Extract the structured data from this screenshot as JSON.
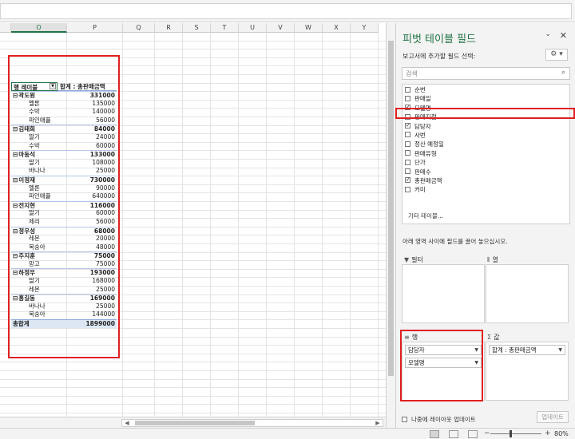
{
  "columns": [
    "O",
    "P",
    "Q",
    "R",
    "S",
    "T",
    "U",
    "V",
    "W",
    "X",
    "Y"
  ],
  "pivot": {
    "row_label_header": "행 레이블",
    "sum_header": "합계 : 총판매금액",
    "groups": [
      {
        "name": "곽도원",
        "total": "331000",
        "items": [
          {
            "name": "멜론",
            "value": "135000"
          },
          {
            "name": "수박",
            "value": "140000"
          },
          {
            "name": "파인애플",
            "value": "56000"
          }
        ]
      },
      {
        "name": "김태희",
        "total": "84000",
        "items": [
          {
            "name": "딸기",
            "value": "24000"
          },
          {
            "name": "수박",
            "value": "60000"
          }
        ]
      },
      {
        "name": "마동석",
        "total": "133000",
        "items": [
          {
            "name": "딸기",
            "value": "108000"
          },
          {
            "name": "바나나",
            "value": "25000"
          }
        ]
      },
      {
        "name": "이정재",
        "total": "730000",
        "items": [
          {
            "name": "멜론",
            "value": "90000"
          },
          {
            "name": "파인애플",
            "value": "640000"
          }
        ]
      },
      {
        "name": "전지현",
        "total": "116000",
        "items": [
          {
            "name": "딸기",
            "value": "60000"
          },
          {
            "name": "체리",
            "value": "56000"
          }
        ]
      },
      {
        "name": "정우성",
        "total": "68000",
        "items": [
          {
            "name": "레몬",
            "value": "20000"
          },
          {
            "name": "복숭아",
            "value": "48000"
          }
        ]
      },
      {
        "name": "주지훈",
        "total": "75000",
        "items": [
          {
            "name": "망고",
            "value": "75000"
          }
        ]
      },
      {
        "name": "하정우",
        "total": "193000",
        "items": [
          {
            "name": "딸기",
            "value": "168000"
          },
          {
            "name": "레몬",
            "value": "25000"
          }
        ]
      },
      {
        "name": "홍길동",
        "total": "169000",
        "items": [
          {
            "name": "바나나",
            "value": "25000"
          },
          {
            "name": "복숭아",
            "value": "144000"
          }
        ]
      }
    ],
    "grand_total_label": "총합계",
    "grand_total": "1899000"
  },
  "pane": {
    "title": "피벗 테이블 필드",
    "subtitle": "보고서에 추가할 필드 선택:",
    "search_placeholder": "검색",
    "fields": [
      {
        "name": "순번",
        "checked": false
      },
      {
        "name": "판매일",
        "checked": false
      },
      {
        "name": "모델명",
        "checked": true
      },
      {
        "name": "판매지점",
        "checked": false
      },
      {
        "name": "담당자",
        "checked": true
      },
      {
        "name": "사번",
        "checked": false
      },
      {
        "name": "정산 예정일",
        "checked": false
      },
      {
        "name": "판매유형",
        "checked": false
      },
      {
        "name": "단가",
        "checked": false
      },
      {
        "name": "판매수",
        "checked": false
      },
      {
        "name": "총판매금액",
        "checked": true
      },
      {
        "name": "커미",
        "checked": false
      }
    ],
    "more_tables": "기타 테이블...",
    "drag_hint": "아래 영역 사이에 필드를 끌어 놓으십시오.",
    "areas": {
      "filter_label": "필터",
      "columns_label": "열",
      "rows_label": "행",
      "values_label": "값",
      "rows": [
        "담당자",
        "모델명"
      ],
      "values": [
        "합계 : 총판매금액"
      ]
    },
    "defer_label": "나중에 레이아웃 업데이트",
    "update_button": "업데이트"
  },
  "status": {
    "zoom": "80%"
  }
}
